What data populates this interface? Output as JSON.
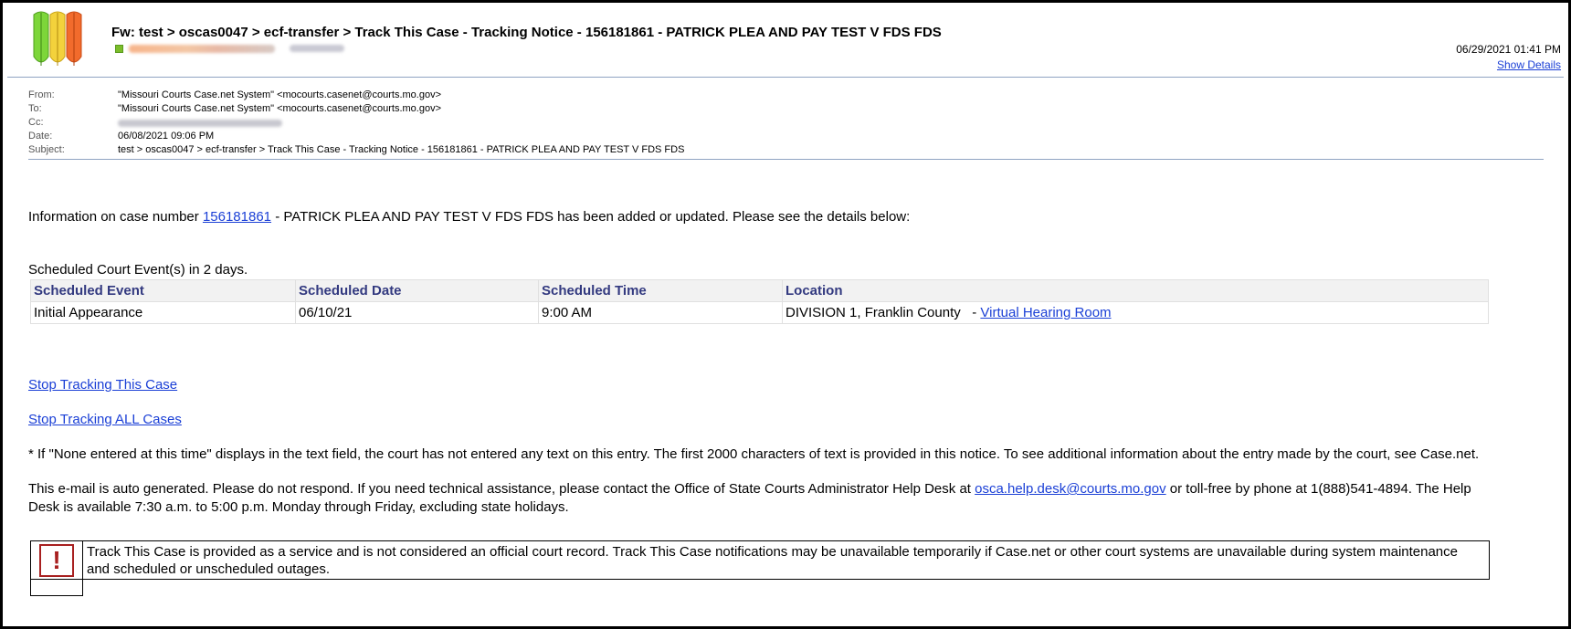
{
  "header": {
    "subject": "Fw: test > oscas0047 > ecf-transfer > Track This Case - Tracking Notice - 156181861 - PATRICK PLEA AND PAY TEST V FDS FDS",
    "date": "06/29/2021 01:41 PM",
    "show_details": "Show Details"
  },
  "fields": {
    "from_label": "From:",
    "from_value": "\"Missouri Courts Case.net System\" <mocourts.casenet@courts.mo.gov>",
    "to_label": "To:",
    "to_value": "\"Missouri Courts Case.net System\" <mocourts.casenet@courts.mo.gov>",
    "cc_label": "Cc:",
    "date_label": "Date:",
    "date_value": "06/08/2021 09:06 PM",
    "subject_label": "Subject:",
    "subject_value": "test > oscas0047 > ecf-transfer > Track This Case - Tracking Notice - 156181861 - PATRICK PLEA AND PAY TEST V FDS  FDS"
  },
  "body": {
    "intro_prefix": "Information on case number ",
    "case_number": "156181861",
    "intro_suffix": " - PATRICK PLEA AND PAY TEST V FDS FDS has been added or updated. Please see the details below:",
    "scheduled_heading": "Scheduled Court Event(s) in 2 days.",
    "table": {
      "headers": [
        "Scheduled Event",
        "Scheduled Date",
        "Scheduled Time",
        "Location"
      ],
      "row": {
        "event": "Initial Appearance",
        "date": "06/10/21",
        "time": "9:00 AM",
        "location": "DIVISION 1, Franklin County   - ",
        "location_link": "Virtual Hearing Room"
      }
    },
    "stop_tracking": "Stop Tracking This Case",
    "stop_tracking_all": "Stop Tracking ALL Cases",
    "note": "* If \"None entered at this time\" displays in the text field, the court has not entered any text on this entry. The first 2000 characters of text is provided in this notice. To see additional information about the entry made by the court, see Case.net.",
    "auto_prefix": "This e-mail is auto generated. Please do not respond. If you need technical assistance, please contact the Office of State Courts Administrator Help Desk at ",
    "help_email": "osca.help.desk@courts.mo.gov",
    "auto_suffix": " or toll-free by phone at 1(888)541-4894. The Help",
    "auto_line2": "Desk is available 7:30 a.m. to 5:00 p.m. Monday through Friday, excluding state holidays.",
    "notice": "Track This Case is provided as a service and is not considered an official court record. Track This Case notifications may be unavailable temporarily if Case.net or other court systems are unavailable during system maintenance and scheduled or unscheduled outages.",
    "notice_icon": "!"
  },
  "colors": {
    "link": "#1a3fd6",
    "table_header_text": "#333a80",
    "alert_red": "#a82020"
  }
}
